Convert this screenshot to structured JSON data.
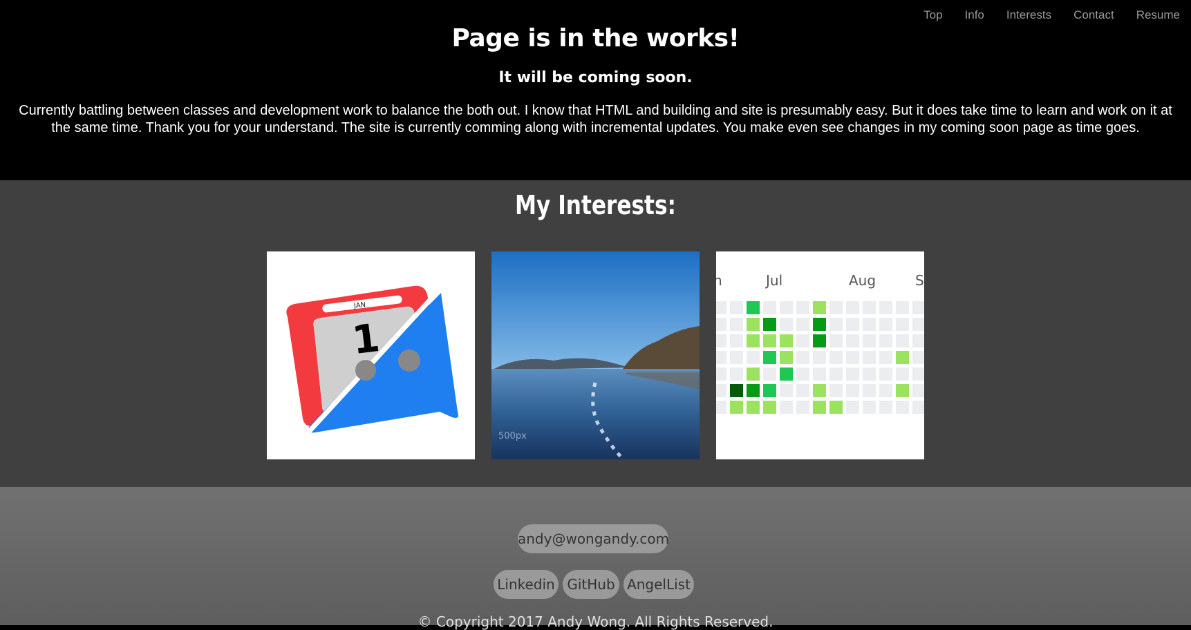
{
  "nav": {
    "items": [
      "Top",
      "Info",
      "Interests",
      "Contact",
      "Resume"
    ]
  },
  "hero": {
    "title": "Page is in the works!",
    "subtitle": "It will be coming soon.",
    "body": "Currently battling between classes and development work to balance the both out. I know that HTML and building and site is presumably easy. But it does take time to learn and work on it at the same time. Thank you for your understand. The site is currently comming along with incremental updates. You make even see changes in my coming soon page as time goes."
  },
  "interests": {
    "title": "My Interests:",
    "calendar_icon": {
      "month": "JAN",
      "day": "1"
    },
    "photo": {
      "watermark": "500px"
    },
    "contributions": {
      "months": [
        "n",
        "Jul",
        "Aug",
        "S"
      ]
    }
  },
  "footer": {
    "email": "andy@wongandy.com",
    "links": [
      "Linkedin",
      "GitHub",
      "AngelList"
    ],
    "copyright": "© Copyright 2017 Andy Wong. All Rights Reserved."
  },
  "colors": {
    "hero_bg": "#000000",
    "interests_bg": "#404040",
    "footer_bg": "#6a6a6a",
    "pill_bg": "#9a9a9a"
  }
}
